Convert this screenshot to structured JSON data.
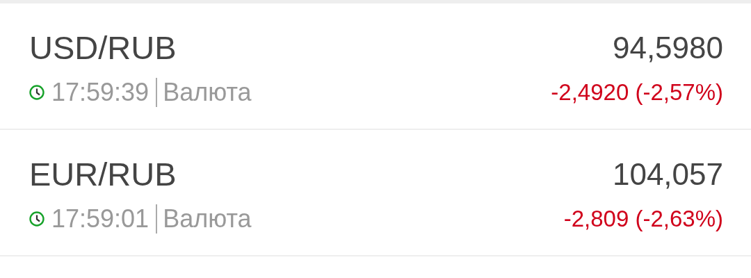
{
  "quotes": [
    {
      "pair": "USD/RUB",
      "price": "94,5980",
      "time": "17:59:39",
      "type": "Валюта",
      "change": "-2,4920 (-2,57%)",
      "negative": true
    },
    {
      "pair": "EUR/RUB",
      "price": "104,057",
      "time": "17:59:01",
      "type": "Валюта",
      "change": "-2,809 (-2,63%)",
      "negative": true
    }
  ]
}
